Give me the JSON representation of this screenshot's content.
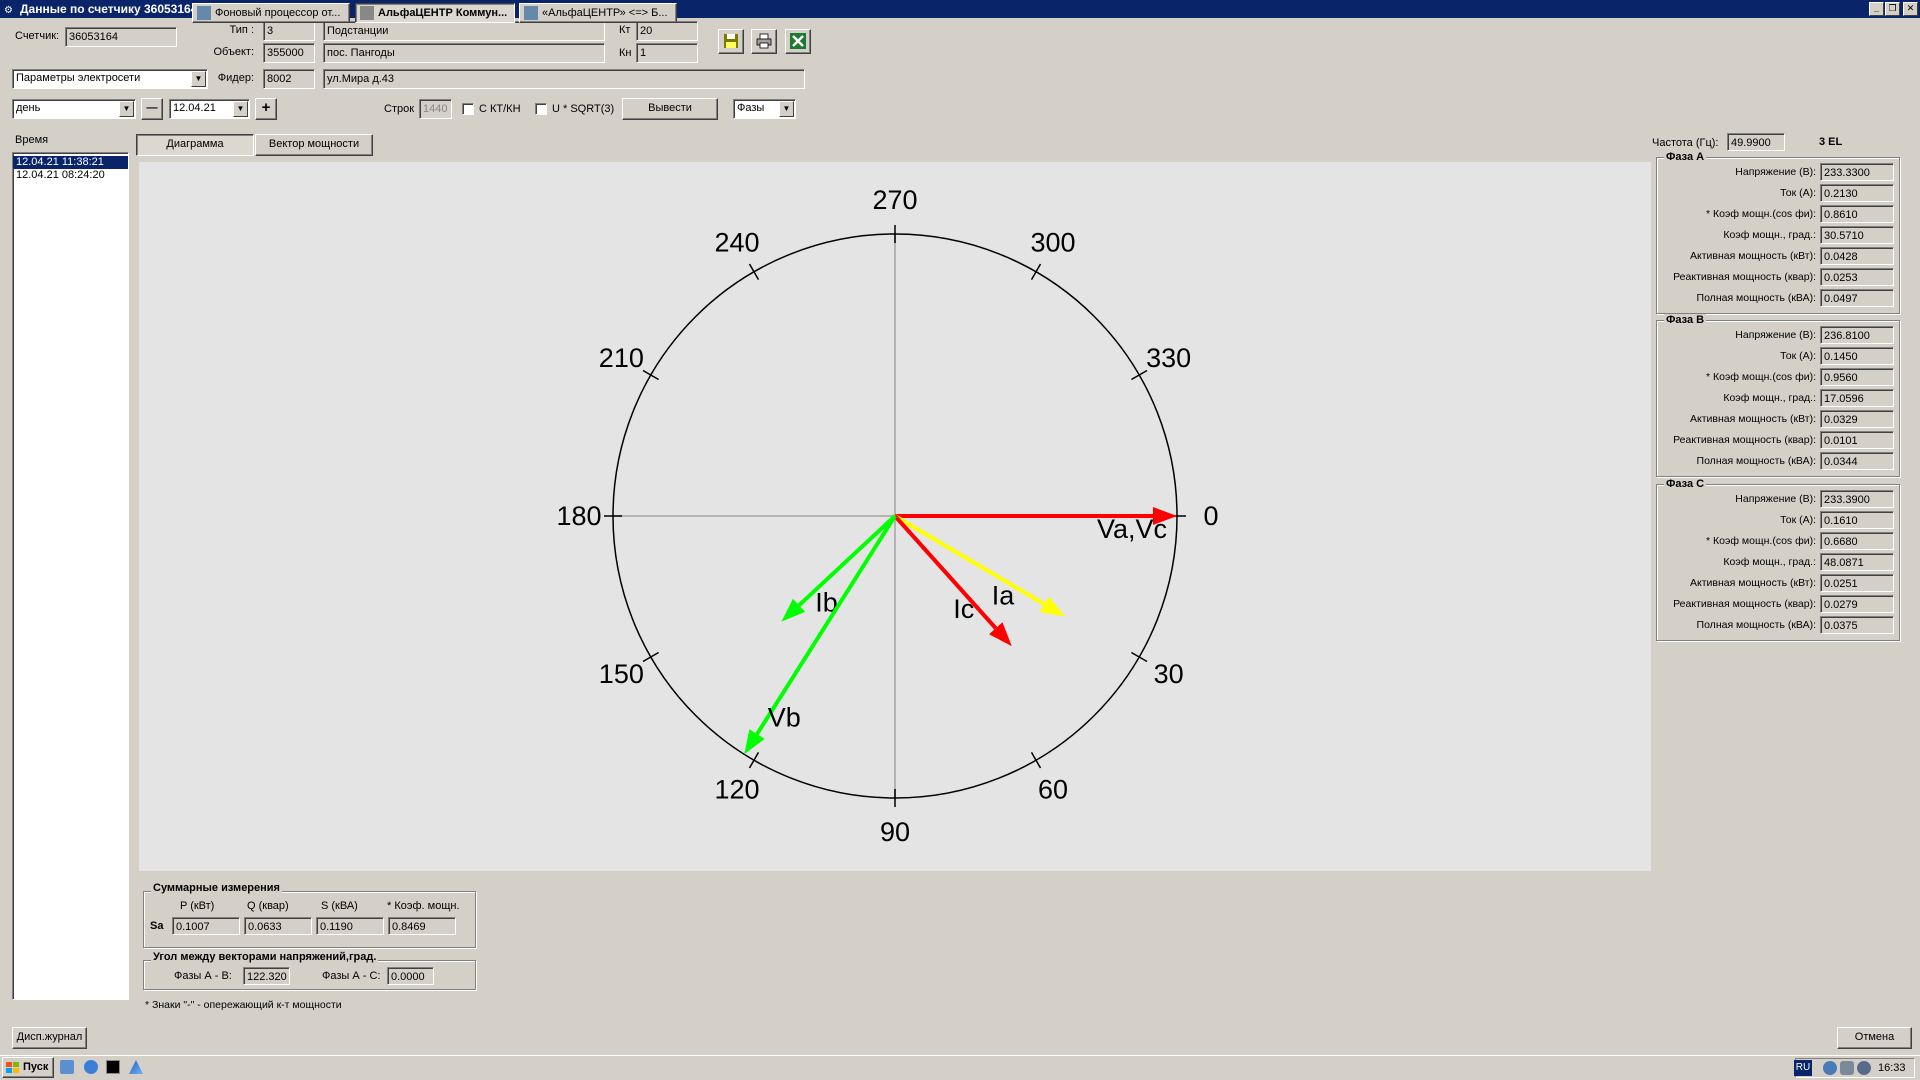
{
  "window": {
    "title": "Данные по счетчику 36053164"
  },
  "header": {
    "meter_label": "Счетчик:",
    "meter_value": "36053164",
    "type_label": "Тип :",
    "type_code": "3",
    "type_name": "Подстанции",
    "object_label": "Объект:",
    "object_code": "355000",
    "object_name": "пос. Пангоды",
    "kt_label": "Кт",
    "kt_value": "20",
    "kn_label": "Кн",
    "kn_value": "1",
    "feeder_label": "Фидер:",
    "feeder_code": "8002",
    "feeder_address": "ул.Мира д.43",
    "params_select": "Параметры электросети"
  },
  "toolbar": {
    "period_select": "день",
    "minus": "—",
    "date_value": "12.04.21",
    "plus": "+",
    "rows_label": "Строк",
    "rows_value": "1440",
    "ct_vt_label": "С  КТ/КН",
    "sqrt_label": "U * SQRT(3)",
    "output_button": "Вывести",
    "phases_select": "Фазы"
  },
  "time_list": {
    "header": "Время",
    "items": [
      "12.04.21 11:38:21",
      "12.04.21 08:24:20"
    ],
    "selected": 0
  },
  "tabs": [
    "Диаграмма",
    "Вектор мощности"
  ],
  "chart_data": {
    "type": "polar-vector",
    "angle_labels": [
      "0",
      "30",
      "60",
      "90",
      "120",
      "150",
      "180",
      "210",
      "240",
      "270",
      "300",
      "330"
    ],
    "vectors": [
      {
        "name": "Va,Vc",
        "angle": 0,
        "length": 1.0,
        "color": "#ff0000"
      },
      {
        "name": "Ia",
        "angle": 30.57,
        "length": 0.7,
        "color": "#ffff00"
      },
      {
        "name": "Ic",
        "angle": 48.09,
        "length": 0.62,
        "color": "#ff0000"
      },
      {
        "name": "Ib",
        "angle": 137.06,
        "length": 0.55,
        "color": "#00ff00"
      },
      {
        "name": "Vb",
        "angle": 122.32,
        "length": 1.0,
        "color": "#00ff00"
      }
    ]
  },
  "summary": {
    "title": "Суммарные измерения",
    "row_label": "Sa",
    "headers": [
      "P (кВт)",
      "Q (квар)",
      "S (кВА)",
      "* Коэф. мощн."
    ],
    "values": [
      "0.1007",
      "0.0633",
      "0.1190",
      "0.8469"
    ]
  },
  "angles": {
    "title": "Угол между векторами напряжений,град.",
    "ab_label": "Фазы А - В:",
    "ab_value": "122.320",
    "ac_label": "Фазы А - С:",
    "ac_value": "0.0000"
  },
  "footnote": "* Знаки \"-\" - опережающий к-т мощности",
  "right": {
    "freq_label": "Частота (Гц):",
    "freq_value": "49.9900",
    "mode": "3 EL",
    "param_labels": [
      "Напряжение (В):",
      "Ток (А):",
      "* Коэф мощн.(cos фи):",
      "Коэф мощн., град.:",
      "Активная мощность (кВт):",
      "Реактивная мощность (квар):",
      "Полная мощность (кВА):"
    ],
    "phases": [
      {
        "title": "Фаза А",
        "values": [
          "233.3300",
          "0.2130",
          "0.8610",
          "30.5710",
          "0.0428",
          "0.0253",
          "0.0497"
        ]
      },
      {
        "title": "Фаза В",
        "values": [
          "236.8100",
          "0.1450",
          "0.9560",
          "17.0596",
          "0.0329",
          "0.0101",
          "0.0344"
        ]
      },
      {
        "title": "Фаза С",
        "values": [
          "233.3900",
          "0.1610",
          "0.6680",
          "48.0871",
          "0.0251",
          "0.0279",
          "0.0375"
        ]
      }
    ]
  },
  "bottom": {
    "journal_button": "Дисп.журнал",
    "cancel_button": "Отмена"
  },
  "taskbar": {
    "start": "Пуск",
    "tasks": [
      "Фоновый процессор от...",
      "АльфаЦЕНТР Коммун...",
      "«АльфаЦЕНТР» <=> Б..."
    ],
    "lang": "RU",
    "clock": "16:33"
  }
}
